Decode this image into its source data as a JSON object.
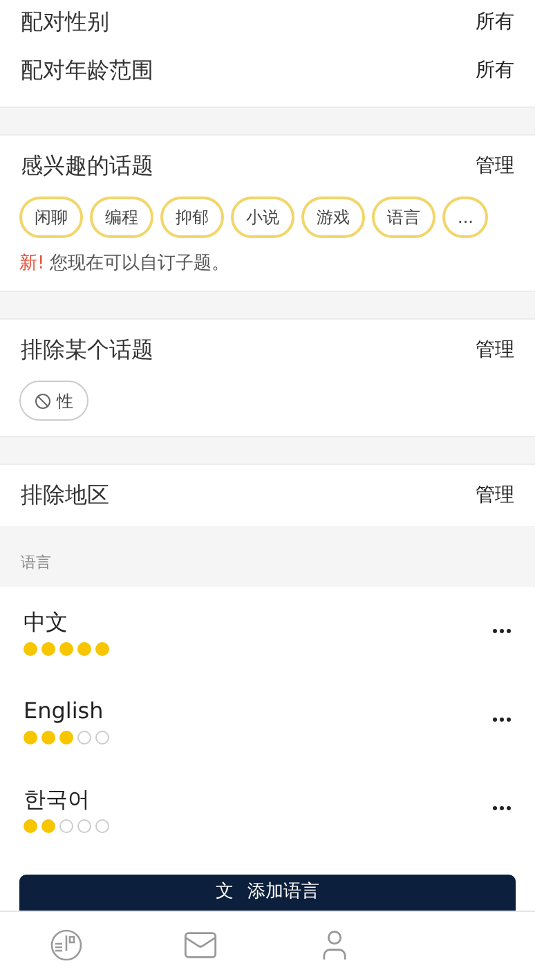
{
  "match_settings": [
    {
      "label": "配对性别",
      "value": "所有"
    },
    {
      "label": "配对年龄范围",
      "value": "所有"
    }
  ],
  "interests": {
    "title": "感兴趣的话题",
    "action": "管理",
    "tags": [
      "闲聊",
      "编程",
      "抑郁",
      "小说",
      "游戏",
      "语言",
      "..."
    ],
    "notice_badge": "新!",
    "notice": "您现在可以自订子题。"
  },
  "excluded_topics": {
    "title": "排除某个话题",
    "action": "管理",
    "tags": [
      "性"
    ]
  },
  "excluded_regions": {
    "title": "排除地区",
    "action": "管理"
  },
  "languages": {
    "header": "语言",
    "items": [
      {
        "name": "中文",
        "stars": 5
      },
      {
        "name": "English",
        "stars": 3
      },
      {
        "name": "한국어",
        "stars": 2
      }
    ],
    "add_button": {
      "icon": "文",
      "label": "添加语言"
    }
  },
  "tab_bar": [
    {
      "kind": "card"
    },
    {
      "kind": "mail"
    },
    {
      "kind": "person"
    }
  ]
}
